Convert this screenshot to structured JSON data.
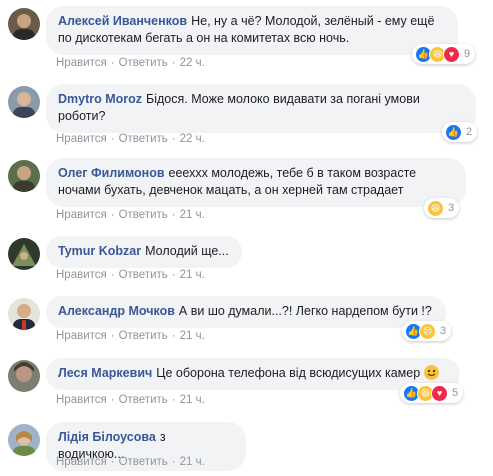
{
  "actions": {
    "like": "Нравится",
    "reply": "Ответить"
  },
  "comments": [
    {
      "author": "Алексей Иванченков",
      "text": "Не, ну а чё? Молодой, зелёный - ему ещё по дискотекам бегать а он на комитетах всю ночь.",
      "time": "22 ч.",
      "reactions": [
        "like-icon",
        "haha-icon",
        "love-icon"
      ],
      "reaction_count": "9"
    },
    {
      "author": "Dmytro Moroz",
      "text": "Бідося. Може молоко видавати за погані умови роботи?",
      "time": "22 ч.",
      "reactions": [
        "like-icon"
      ],
      "reaction_count": "2"
    },
    {
      "author": "Олег Филимонов",
      "text": "еееххх молодежь, тебе б в таком возрасте ночами бухать, девченок мацать, а он херней там страдает",
      "time": "21 ч.",
      "reactions": [
        "haha-icon"
      ],
      "reaction_count": "3"
    },
    {
      "author": "Tymur Kobzar",
      "text": "Молодий ще...",
      "time": "21 ч.",
      "reactions": [],
      "reaction_count": ""
    },
    {
      "author": "Александр Мочков",
      "text": "А ви шо думали...?! Легко нардепом бути !?",
      "time": "21 ч.",
      "reactions": [
        "like-icon",
        "sad-icon"
      ],
      "reaction_count": "3"
    },
    {
      "author": "Леся Маркевич",
      "text": "Це оборона телефона від всюдисущих камер",
      "time": "21 ч.",
      "reactions": [
        "like-icon",
        "haha-icon",
        "love-icon"
      ],
      "reaction_count": "5"
    },
    {
      "author": "Лідія Білоусова",
      "text": "з водичкою...",
      "time": "21 ч.",
      "reactions": [],
      "reaction_count": ""
    }
  ],
  "colors": {
    "author": "#385898",
    "bubble": "#f2f3f5",
    "meta": "#90949c",
    "like": "#1877f2",
    "haha": "#f7c43b",
    "love": "#f0284a"
  }
}
